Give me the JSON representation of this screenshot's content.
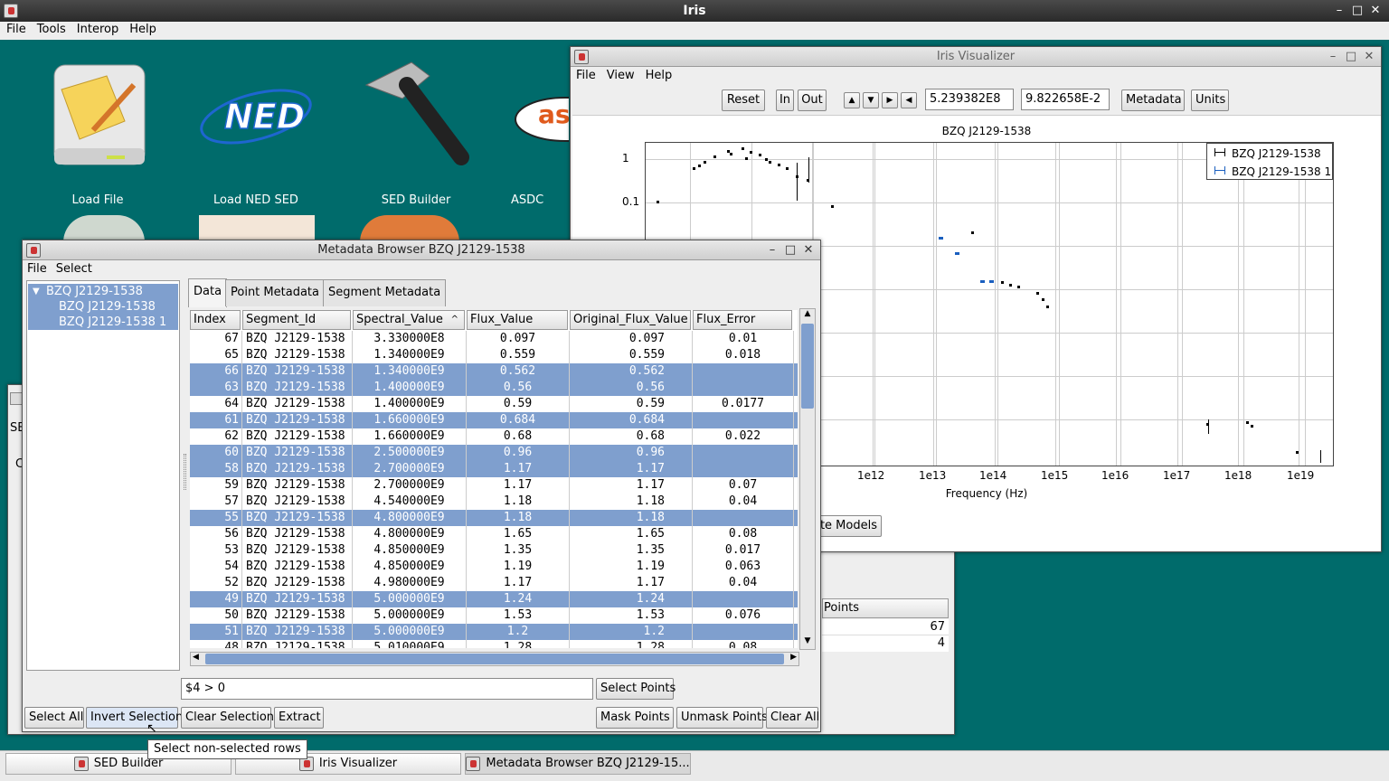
{
  "app": {
    "title": "Iris",
    "menu": [
      "File",
      "Tools",
      "Interop",
      "Help"
    ]
  },
  "desktop_icons": [
    {
      "label": "Load File",
      "icon": "folder-drive-icon"
    },
    {
      "label": "Load NED SED",
      "icon": "ned-logo-icon"
    },
    {
      "label": "SED Builder",
      "icon": "hammer-icon"
    },
    {
      "label": "ASDC",
      "icon": "asi-logo-icon"
    }
  ],
  "visualizer": {
    "title": "Iris Visualizer",
    "menu": [
      "File",
      "View",
      "Help"
    ],
    "toolbar": {
      "reset": "Reset",
      "zoom_in": "In",
      "zoom_out": "Out",
      "x_value": "5.239382E8",
      "y_value": "9.822658E-2",
      "metadata": "Metadata",
      "units": "Units"
    },
    "plot_title": "BZQ J2129-1538",
    "xlabel": "Frequency (Hz)",
    "y_ticks": [
      "1",
      "0.1"
    ],
    "x_ticks": [
      "1e12",
      "1e13",
      "1e14",
      "1e15",
      "1e16",
      "1e17",
      "1e18",
      "1e19"
    ],
    "legend": [
      "BZQ J2129-1538",
      "BZQ J2129-1538 1"
    ],
    "models_button": "te Models"
  },
  "sed_builder_partial": {
    "column_header": "Points",
    "counts": [
      "67",
      "4"
    ],
    "label_se": "SE",
    "label_c": "C"
  },
  "metadata_browser": {
    "title": "Metadata Browser BZQ J2129-1538",
    "menu": [
      "File",
      "Select"
    ],
    "tree": {
      "root": "BZQ J2129-1538",
      "children": [
        "BZQ J2129-1538",
        "BZQ J2129-1538 1"
      ]
    },
    "tabs": [
      "Data",
      "Point Metadata",
      "Segment Metadata"
    ],
    "columns": [
      "Index",
      "Segment_Id",
      "Spectral_Value",
      "Flux_Value",
      "Original_Flux_Value",
      "Flux_Error"
    ],
    "rows": [
      {
        "index": "67",
        "segment": "BZQ J2129-1538",
        "spectral": "3.330000E8",
        "flux": "0.097",
        "orig": "0.097",
        "err": "0.01",
        "sel": false
      },
      {
        "index": "65",
        "segment": "BZQ J2129-1538",
        "spectral": "1.340000E9",
        "flux": "0.559",
        "orig": "0.559",
        "err": "0.018",
        "sel": false
      },
      {
        "index": "66",
        "segment": "BZQ J2129-1538",
        "spectral": "1.340000E9",
        "flux": "0.562",
        "orig": "0.562",
        "err": "",
        "sel": true
      },
      {
        "index": "63",
        "segment": "BZQ J2129-1538",
        "spectral": "1.400000E9",
        "flux": "0.56",
        "orig": "0.56",
        "err": "",
        "sel": true
      },
      {
        "index": "64",
        "segment": "BZQ J2129-1538",
        "spectral": "1.400000E9",
        "flux": "0.59",
        "orig": "0.59",
        "err": "0.0177",
        "sel": false
      },
      {
        "index": "61",
        "segment": "BZQ J2129-1538",
        "spectral": "1.660000E9",
        "flux": "0.684",
        "orig": "0.684",
        "err": "",
        "sel": true
      },
      {
        "index": "62",
        "segment": "BZQ J2129-1538",
        "spectral": "1.660000E9",
        "flux": "0.68",
        "orig": "0.68",
        "err": "0.022",
        "sel": false
      },
      {
        "index": "60",
        "segment": "BZQ J2129-1538",
        "spectral": "2.500000E9",
        "flux": "0.96",
        "orig": "0.96",
        "err": "",
        "sel": true
      },
      {
        "index": "58",
        "segment": "BZQ J2129-1538",
        "spectral": "2.700000E9",
        "flux": "1.17",
        "orig": "1.17",
        "err": "",
        "sel": true
      },
      {
        "index": "59",
        "segment": "BZQ J2129-1538",
        "spectral": "2.700000E9",
        "flux": "1.17",
        "orig": "1.17",
        "err": "0.07",
        "sel": false
      },
      {
        "index": "57",
        "segment": "BZQ J2129-1538",
        "spectral": "4.540000E9",
        "flux": "1.18",
        "orig": "1.18",
        "err": "0.04",
        "sel": false
      },
      {
        "index": "55",
        "segment": "BZQ J2129-1538",
        "spectral": "4.800000E9",
        "flux": "1.18",
        "orig": "1.18",
        "err": "",
        "sel": true
      },
      {
        "index": "56",
        "segment": "BZQ J2129-1538",
        "spectral": "4.800000E9",
        "flux": "1.65",
        "orig": "1.65",
        "err": "0.08",
        "sel": false
      },
      {
        "index": "53",
        "segment": "BZQ J2129-1538",
        "spectral": "4.850000E9",
        "flux": "1.35",
        "orig": "1.35",
        "err": "0.017",
        "sel": false
      },
      {
        "index": "54",
        "segment": "BZQ J2129-1538",
        "spectral": "4.850000E9",
        "flux": "1.19",
        "orig": "1.19",
        "err": "0.063",
        "sel": false
      },
      {
        "index": "52",
        "segment": "BZQ J2129-1538",
        "spectral": "4.980000E9",
        "flux": "1.17",
        "orig": "1.17",
        "err": "0.04",
        "sel": false
      },
      {
        "index": "49",
        "segment": "BZQ J2129-1538",
        "spectral": "5.000000E9",
        "flux": "1.24",
        "orig": "1.24",
        "err": "",
        "sel": true
      },
      {
        "index": "50",
        "segment": "BZQ J2129-1538",
        "spectral": "5.000000E9",
        "flux": "1.53",
        "orig": "1.53",
        "err": "0.076",
        "sel": false
      },
      {
        "index": "51",
        "segment": "BZQ J2129-1538",
        "spectral": "5.000000E9",
        "flux": "1.2",
        "orig": "1.2",
        "err": "",
        "sel": true
      },
      {
        "index": "48",
        "segment": "BZQ J2129-1538",
        "spectral": "5.010000E9",
        "flux": "1.28",
        "orig": "1.28",
        "err": "0.08",
        "sel": false
      }
    ],
    "filter_expression": "$4 > 0",
    "buttons": {
      "select_points": "Select Points",
      "select_all": "Select All",
      "invert_selection": "Invert Selection",
      "clear_selection": "Clear Selection",
      "extract": "Extract",
      "mask_points": "Mask Points",
      "unmask_points": "Unmask Points",
      "clear_all": "Clear All"
    },
    "tooltip": "Select non-selected rows"
  },
  "taskbar": [
    "SED Builder",
    "Iris Visualizer",
    "Metadata Browser BZQ J2129-15..."
  ]
}
